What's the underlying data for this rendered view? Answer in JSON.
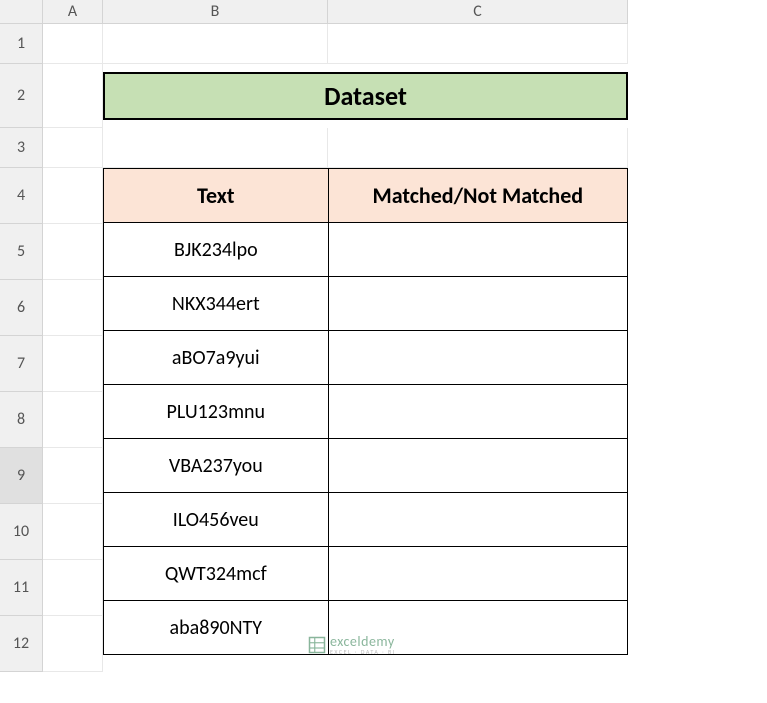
{
  "columns": [
    "A",
    "B",
    "C"
  ],
  "rows": [
    "1",
    "2",
    "3",
    "4",
    "5",
    "6",
    "7",
    "8",
    "9",
    "10",
    "11",
    "12"
  ],
  "selected_row": "9",
  "title": "Dataset",
  "table": {
    "headers": {
      "text": "Text",
      "matched": "Matched/Not Matched"
    },
    "data": [
      {
        "text": "BJK234lpo",
        "matched": ""
      },
      {
        "text": "NKX344ert",
        "matched": ""
      },
      {
        "text": "aBO7a9yui",
        "matched": ""
      },
      {
        "text": "PLU123mnu",
        "matched": ""
      },
      {
        "text": "VBA237you",
        "matched": ""
      },
      {
        "text": "ILO456veu",
        "matched": ""
      },
      {
        "text": "QWT324mcf",
        "matched": ""
      },
      {
        "text": "aba890NTY",
        "matched": ""
      }
    ]
  },
  "watermark": {
    "main": "exceldemy",
    "sub": "EXCEL · DATA · BI"
  },
  "colors": {
    "title_bg": "#c6e0b4",
    "header_bg": "#fce4d6",
    "grid_header_bg": "#f0f0f0"
  }
}
